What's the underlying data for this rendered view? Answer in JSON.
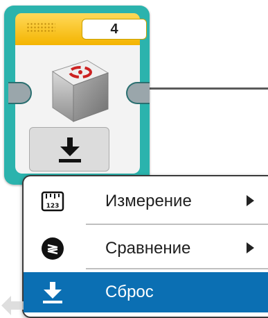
{
  "block": {
    "port_value": "4",
    "icon": "rotation-sensor-icon",
    "mode_icon": "reset-download-icon"
  },
  "menu": {
    "items": [
      {
        "label": "Измерение",
        "icon": "measure-ruler-icon",
        "has_submenu": true
      },
      {
        "label": "Сравнение",
        "icon": "compare-icon",
        "has_submenu": true
      },
      {
        "label": "Сброс",
        "icon": "reset-download-icon",
        "has_submenu": false,
        "selected": true
      }
    ]
  },
  "colors": {
    "block_teal": "#2bb3ad",
    "header_yellow": "#f4b400",
    "selected_blue": "#0b6fb3"
  }
}
